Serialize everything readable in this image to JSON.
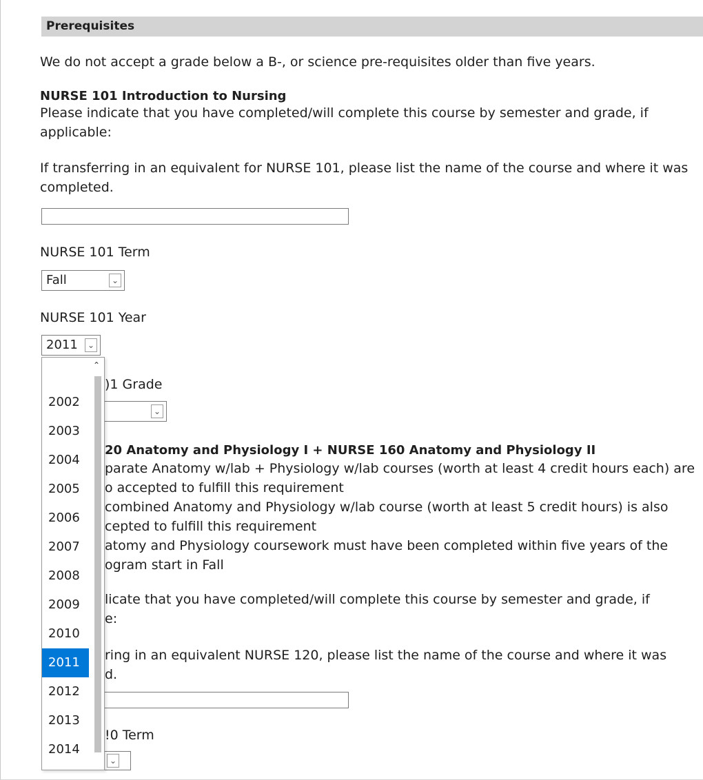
{
  "section": {
    "title": "Prerequisites"
  },
  "intro": "We do not accept a grade below a B-, or science pre-requisites older than five years.",
  "nurse101": {
    "heading": "NURSE 101 Introduction to Nursing",
    "instructions_1": "Please indicate that you have completed/will complete this course by semester and grade, if",
    "instructions_2": "applicable:",
    "transfer_1": "If transferring in an equivalent for NURSE 101, please list the name of the course and where it was",
    "transfer_2": "completed.",
    "transfer_value": "",
    "term_label": "NURSE 101 Term",
    "term_value": "Fall",
    "year_label": "NURSE 101 Year",
    "year_value": "2011",
    "grade_label_partial": ")1 Grade",
    "year_options": [
      "2002",
      "2003",
      "2004",
      "2005",
      "2006",
      "2007",
      "2008",
      "2009",
      "2010",
      "2011",
      "2012",
      "2013",
      "2014"
    ],
    "selected_year": "2011"
  },
  "nurse120": {
    "heading_partial": "20 Anatomy and Physiology I + NURSE 160 Anatomy and Physiology II",
    "lines": [
      "parate Anatomy w/lab + Physiology w/lab courses (worth at least 4 credit hours each) are",
      "o accepted to fulfill this requirement",
      "combined Anatomy and Physiology w/lab course (worth at least 5 credit hours) is also",
      "cepted to fulfill this requirement",
      "atomy and Physiology coursework must have been completed within five years of the",
      "ogram start in Fall"
    ],
    "instr_1": "licate that you have completed/will complete this course by semester and grade, if",
    "instr_2": "e:",
    "transfer_1": "ring in an equivalent NURSE 120, please list the name of the course and where it was",
    "transfer_2": "d.",
    "term_label_partial": "!0 Term"
  },
  "icons": {
    "dropdown_arrow": "chevron-down-icon",
    "scroll_up": "chevron-up-icon"
  }
}
